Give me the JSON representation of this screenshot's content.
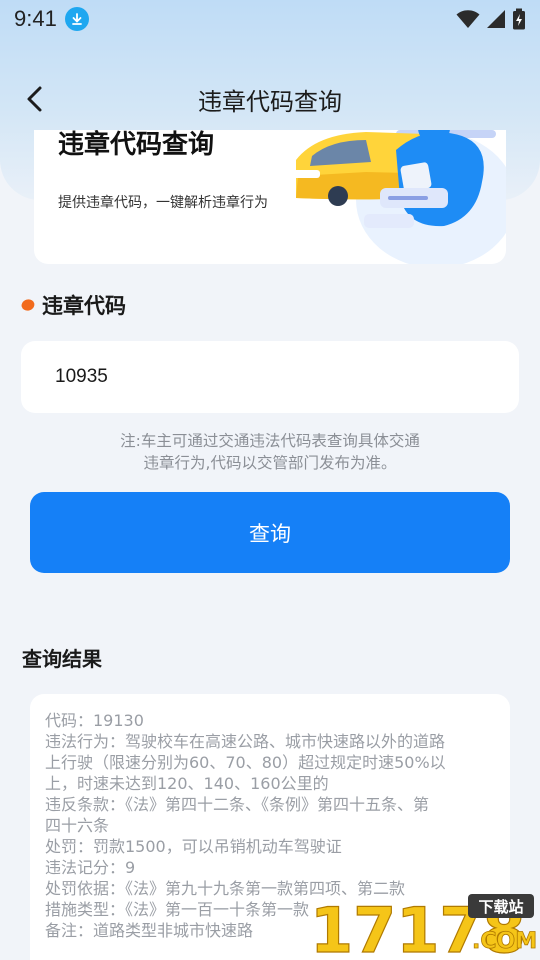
{
  "status_bar": {
    "time": "9:41",
    "icons": [
      "download-icon",
      "wifi-icon",
      "signal-icon",
      "battery-charging-icon"
    ]
  },
  "nav": {
    "back_icon": "chevron-left-icon",
    "title": "违章代码查询"
  },
  "banner": {
    "title": "违章代码查询",
    "subtitle": "提供违章代码，一键解析违章行为"
  },
  "form": {
    "section_title": "违章代码",
    "code_value": "10935",
    "note_line1": "注:车主可通过交通违法代码表查询具体交通",
    "note_line2": "违章行为,代码以交管部门发布为准。",
    "query_label": "查询"
  },
  "results": {
    "title": "查询结果",
    "lines": [
      "代码：19130",
      "违法行为：驾驶校车在高速公路、城市快速路以外的道路",
      "上行驶（限速分别为60、70、80）超过规定时速50%以",
      "上，时速未达到120、140、160公里的",
      "违反条款：《法》第四十二条、《条例》第四十五条、第",
      "四十六条",
      "处罚：罚款1500，可以吊销机动车驾驶证",
      "违法记分：9",
      "处罚依据：《法》第九十九条第一款第四项、第二款",
      "措施类型：《法》第一百一十条第一款",
      "备注：道路类型非城市快速路"
    ]
  },
  "watermark": {
    "number": "17178",
    "tag": "下载站",
    "domain": ".COM"
  },
  "colors": {
    "accent": "#1580f7",
    "dot": "#f26b1d",
    "page_bg": "#f1f4f9"
  }
}
